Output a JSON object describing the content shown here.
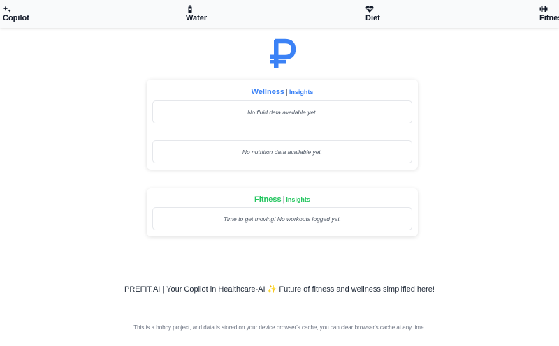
{
  "nav": {
    "items": [
      {
        "label": "Copilot",
        "icon": "sparkle-icon"
      },
      {
        "label": "Water",
        "icon": "water-bottle-icon"
      },
      {
        "label": "Diet",
        "icon": "heart-pulse-icon"
      },
      {
        "label": "Fitness",
        "icon": "dumbbell-icon"
      }
    ]
  },
  "logo": {
    "icon": "ruble-p-logo-icon",
    "color": "#3b82f6"
  },
  "wellness": {
    "title": "Wellness",
    "separator": "|",
    "subtitle": "Insights",
    "fluid_empty": "No fluid data available yet.",
    "nutrition_empty": "No nutrition data available yet."
  },
  "fitness": {
    "title": "Fitness",
    "separator": "|",
    "subtitle": "Insights",
    "workouts_empty": "Time to get moving! No workouts logged yet."
  },
  "footer": {
    "tagline_before": "PREFIT.AI | Your Copilot in Healthcare-AI",
    "tagline_sparkle": "✨",
    "tagline_after": "Future of fitness and wellness simplified here!",
    "disclaimer": "This is a hobby project, and data is stored on your device browser's cache, you can clear browser's cache at any time."
  },
  "colors": {
    "wellness_accent": "#3b82f6",
    "fitness_accent": "#22c55e"
  }
}
